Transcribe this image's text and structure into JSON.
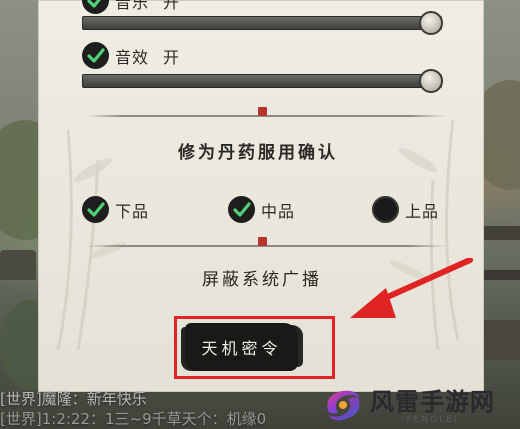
{
  "audio": {
    "music": {
      "label": "音乐",
      "state": "开",
      "checked": true,
      "volume": 1.0
    },
    "sfx": {
      "label": "音效",
      "state": "开",
      "checked": true,
      "volume": 1.0
    }
  },
  "pill_confirm": {
    "title": "修为丹药服用确认",
    "options": [
      {
        "label": "下品",
        "checked": true
      },
      {
        "label": "中品",
        "checked": true
      },
      {
        "label": "上品",
        "checked": false
      }
    ]
  },
  "broadcast": {
    "title": "屏蔽系统广播"
  },
  "secret_button": {
    "label": "天机密令"
  },
  "chat": {
    "line1": {
      "channel": "[世界]",
      "text": "魔隆：新年快乐"
    },
    "line2": {
      "channel": "[世界]",
      "text": "1:2:22：1三~9千草天个：机缘0"
    }
  },
  "watermark": {
    "name": "风雷手游网",
    "sub": "FENGLEI"
  },
  "colors": {
    "highlight": "#e02323",
    "seal": "#b6352f",
    "panel": "#ebe8df"
  }
}
